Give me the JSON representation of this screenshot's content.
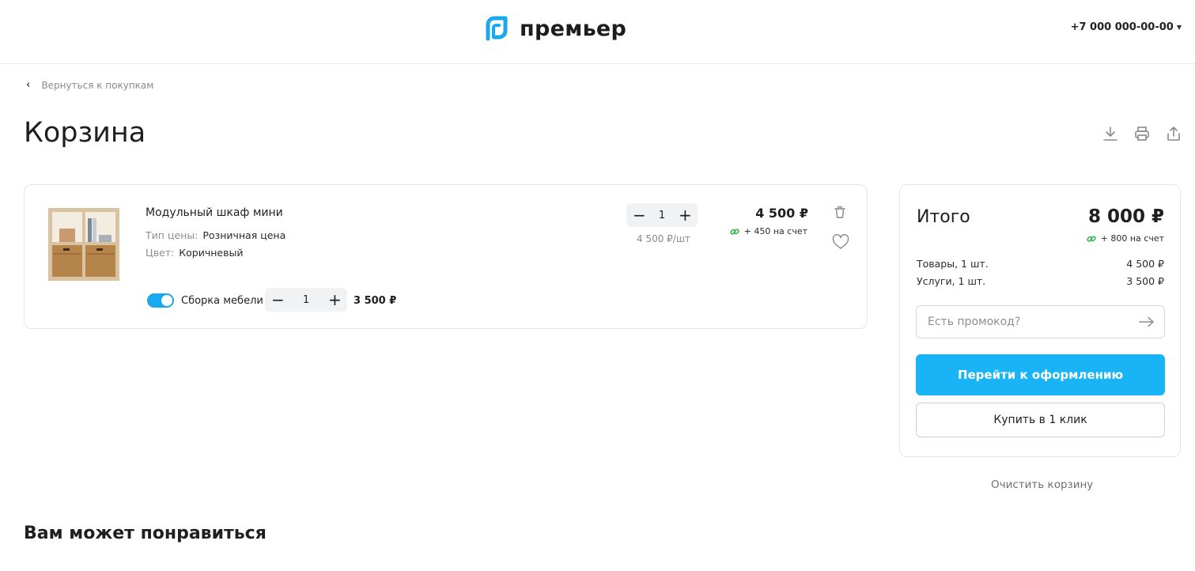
{
  "header": {
    "logo_text": "премьер",
    "phone": "+7 000 000-00-00",
    "brand_color": "#1aa9ec"
  },
  "nav": {
    "back_label": "Вернуться к покупкам"
  },
  "page": {
    "title": "Корзина",
    "actions": [
      "download-icon",
      "print-icon",
      "share-icon"
    ]
  },
  "cart": {
    "items": [
      {
        "name": "Модульный шкаф мини",
        "price_type_label": "Тип цены:",
        "price_type": "Розничная цена",
        "color_label": "Цвет:",
        "color": "Коричневый",
        "quantity": "1",
        "unit_price": "4 500 ₽/шт",
        "price": "4 500 ₽",
        "bonus": "+ 450 на счет",
        "service": {
          "enabled": true,
          "label": "Сборка мебели",
          "quantity": "1",
          "price": "3 500 ₽"
        }
      }
    ]
  },
  "summary": {
    "title": "Итого",
    "total": "8 000 ₽",
    "bonus": "+ 800 на счет",
    "goods_label": "Товары, 1 шт.",
    "goods_value": "4 500 ₽",
    "services_label": "Услуги, 1 шт.",
    "services_value": "3 500 ₽",
    "promo_placeholder": "Есть промокод?",
    "checkout_label": "Перейти к оформлению",
    "oneclick_label": "Купить в 1 клик"
  },
  "clear_cart_label": "Очистить корзину",
  "recommendations_title": "Вам может понравиться",
  "colors": {
    "accent": "#19b4f5",
    "bonus_green": "#2fb344"
  }
}
